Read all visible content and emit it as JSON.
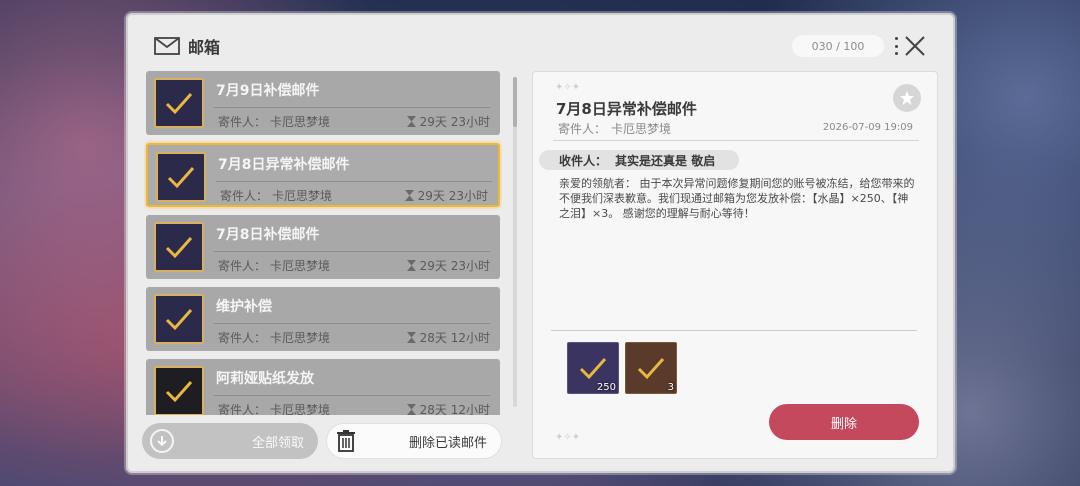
{
  "header": {
    "title": "邮箱",
    "count": "030 / 100"
  },
  "mails": [
    {
      "title": "7月9日补偿邮件",
      "sender_label": "寄件人：",
      "sender": "卡厄思梦境",
      "time": "29天 23小时"
    },
    {
      "title": "7月8日异常补偿邮件",
      "sender_label": "寄件人：",
      "sender": "卡厄思梦境",
      "time": "29天 23小时"
    },
    {
      "title": "7月8日补偿邮件",
      "sender_label": "寄件人：",
      "sender": "卡厄思梦境",
      "time": "29天 23小时"
    },
    {
      "title": "维护补偿",
      "sender_label": "寄件人：",
      "sender": "卡厄思梦境",
      "time": "28天 12小时"
    },
    {
      "title": "阿莉娅贴纸发放",
      "sender_label": "寄件人：",
      "sender": "卡厄思梦境",
      "time": "28天 12小时"
    }
  ],
  "buttons": {
    "claim_all": "全部领取",
    "delete_read": "删除已读邮件",
    "delete": "删除"
  },
  "detail": {
    "title": "7月8日异常补偿邮件",
    "sender_label": "寄件人：",
    "sender": "卡厄思梦境",
    "date": "2026-07-09 19:09",
    "recipient_label": "收件人：",
    "recipient": "其实是还真是 敬启",
    "body": "亲爱的领航者：  由于本次异常问题修复期间您的账号被冻结，给您带来的不便我们深表歉意。我们现通过邮箱为您发放补偿：【水晶】×250、【神之泪】×3。 感谢您的理解与耐心等待！",
    "rewards": [
      {
        "name": "水晶",
        "qty": "250"
      },
      {
        "name": "神之泪",
        "qty": "3"
      }
    ]
  },
  "colors": {
    "selected_border": "#f0b830",
    "delete_button": "#c5495d"
  }
}
